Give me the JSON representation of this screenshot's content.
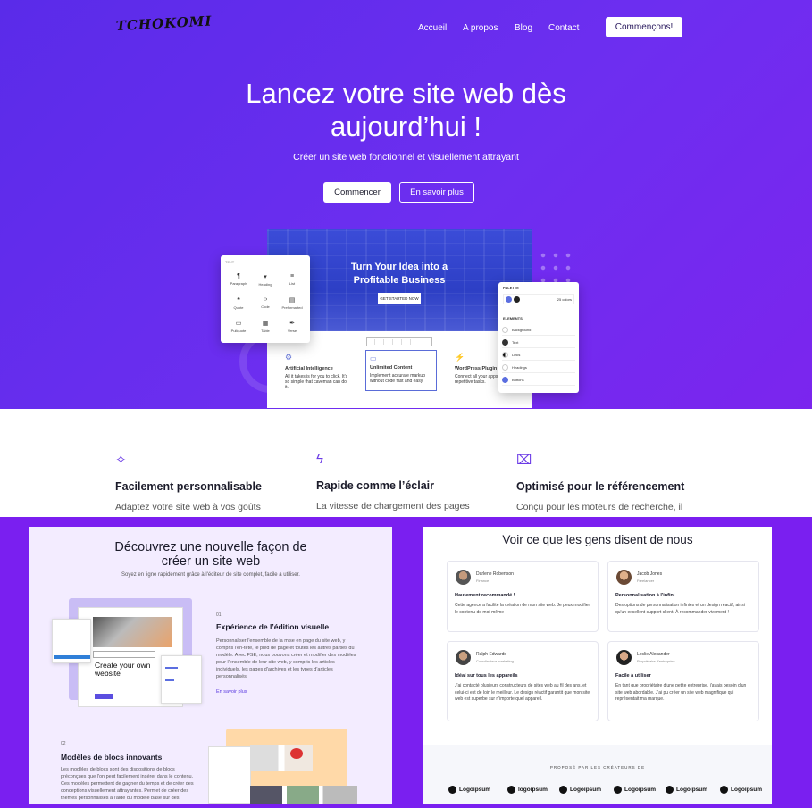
{
  "header": {
    "logo": "TCHOKOMI",
    "nav": [
      "Accueil",
      "A propos",
      "Blog",
      "Contact"
    ],
    "cta": "Commençons!"
  },
  "hero": {
    "title_line1": "Lancez votre site web dès",
    "title_line2": "aujourd’hui !",
    "subtitle": "Créer un site web fonctionnel et visuellement attrayant",
    "btn_primary": "Commencer",
    "btn_secondary": "En savoir plus"
  },
  "mockup": {
    "title_line1": "Turn Your Idea into a",
    "title_line2": "Profitable Business",
    "button": "GET STARTED NOW",
    "features": [
      {
        "title": "Artificial Intelligence",
        "text": "All it takes is for you to click. It's so simple that caveman can do it."
      },
      {
        "title": "Unlimited Content",
        "text": "Implement accurate markup without code fast and easy."
      },
      {
        "title": "WordPress Plugin",
        "text": "Connect all your apps, save repetitive tasks."
      }
    ],
    "blocks_panel": {
      "label": "TEXT",
      "items": [
        "Paragraph",
        "Heading",
        "List",
        "Quote",
        "Code",
        "Preformatted",
        "Pullquote",
        "Table",
        "Verse"
      ]
    },
    "styles_panel": {
      "palette_label": "PALETTE",
      "colors": "25 colors",
      "elements_label": "ELEMENTS",
      "elements": [
        "Background",
        "Text",
        "Links",
        "Headings",
        "Buttons"
      ]
    }
  },
  "features": [
    {
      "icon": "sparkles-icon",
      "title": "Facilement personnalisable",
      "text": "Adaptez votre site web à vos goûts"
    },
    {
      "icon": "lightning-icon",
      "title": "Rapide comme l’éclair",
      "text": "La vitesse de chargement des pages"
    },
    {
      "icon": "presentation-chart-icon",
      "title": "Optimisé pour le référencement",
      "text": "Conçu pour les moteurs de recherche, il"
    }
  ],
  "discover": {
    "title_line1": "Découvrez une nouvelle façon de",
    "title_line2": "créer un site web",
    "subtitle": "Soyez en ligne rapidement grâce à l'éditeur de site complet, facile à utiliser.",
    "feature1": {
      "num": "01",
      "title": "Expérience de l’édition visuelle",
      "text": "Personnaliser l'ensemble de la mise en page du site web, y compris l'en-tête, le pied de page et toutes les autres parties du modèle. Avec FSE, nous pouvons créer et modifier des modèles pour l'ensemble de leur site web, y compris les articles individuels, les pages d'archives et les types d'articles personnalisés.",
      "link": "En savoir plus"
    },
    "editor_heading": "Create your own website",
    "feature2": {
      "num": "02",
      "title": "Modèles de blocs innovants",
      "text": "Les modèles de blocs sont des dispositions de blocs préconçues que l'on peut facilement insérer dans le contenu. Ces modèles permettent de gagner du temps et de créer des conceptions visuellement attrayantes. Permet de créer des thèmes personnalisés à l'aide du modèle basé sur des"
    }
  },
  "testimonials": {
    "title": "Voir ce que les gens disent de nous",
    "items": [
      {
        "name": "Darlene Robertson",
        "role": "Finance",
        "title": "Hautement recommandé !",
        "text": "Cette agence a facilité la création de mon site web. Je peux modifier le contenu de moi-même"
      },
      {
        "name": "Jacob Jones",
        "role": "Freelancer",
        "title": "Personnalisation à l'infini",
        "text": "Des options de personnalisation infinies et un design réactif, ainsi qu'un excellent support client. À recommander vivement !"
      },
      {
        "name": "Ralph Edwards",
        "role": "Coordinateur marketing",
        "title": "Idéal sur tous les appareils",
        "text": "J'ai contacté plusieurs constructeurs de sites web au fil des ans, et celui-ci est de loin le meilleur. Le design réactif garantit que mon site web est superbe sur n'importe quel appareil."
      },
      {
        "name": "Leslie Alexander",
        "role": "Propriétaire d'entreprise",
        "title": "Facile à utiliser",
        "text": "En tant que propriétaire d'une petite entreprise, j'avais besoin d'un site web abordable. J'ai pu créer un site web magnifique qui représentait ma marque."
      }
    ],
    "partners_label": "PROPOSÉ PAR LES CRÉATEURS DE",
    "logos": [
      "Logoipsum",
      "logoipsum",
      "Logoipsum",
      "Logoipsum",
      "Logoipsum",
      "Logoipsum"
    ]
  },
  "colors": {
    "accent": "#6b3be6",
    "hero": "#5a2be9",
    "background": "#7a1ff0"
  }
}
